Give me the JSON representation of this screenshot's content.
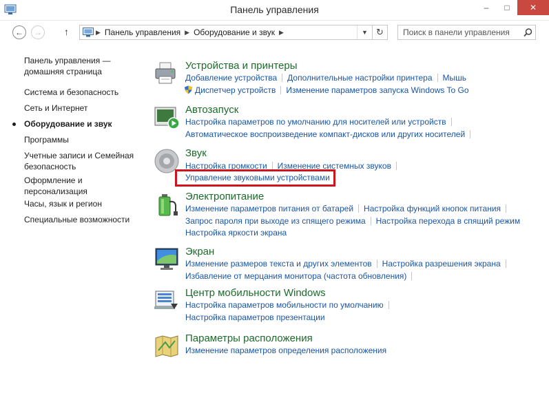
{
  "window": {
    "title": "Панель управления",
    "buttons": {
      "minimize": "–",
      "maximize": "□",
      "close": "✕"
    }
  },
  "address": {
    "crumbs": [
      "Панель управления",
      "Оборудование и звук"
    ],
    "search_placeholder": "Поиск в панели управления"
  },
  "sidebar": {
    "items": [
      "Панель управления — домашняя страница",
      "Система и безопасность",
      "Сеть и Интернет",
      "Оборудование и звук",
      "Программы",
      "Учетные записи и Семейная безопасность",
      "Оформление и персонализация",
      "Часы, язык и регион",
      "Специальные возможности"
    ],
    "current_index": 3
  },
  "categories": {
    "devices": {
      "title": "Устройства и принтеры",
      "links": [
        "Добавление устройства",
        "Дополнительные настройки принтера",
        "Мышь",
        "Диспетчер устройств",
        "Изменение параметров запуска Windows To Go"
      ]
    },
    "autoplay": {
      "title": "Автозапуск",
      "links": [
        "Настройка параметров по умолчанию для носителей или устройств",
        "Автоматическое воспроизведение компакт-дисков или других носителей"
      ]
    },
    "sound": {
      "title": "Звук",
      "links": [
        "Настройка громкости",
        "Изменение системных звуков",
        "Управление звуковыми устройствами"
      ]
    },
    "power": {
      "title": "Электропитание",
      "links": [
        "Изменение параметров питания от батарей",
        "Настройка функций кнопок питания",
        "Запрос пароля при выходе из спящего режима",
        "Настройка перехода в спящий режим",
        "Настройка яркости экрана"
      ]
    },
    "display": {
      "title": "Экран",
      "links": [
        "Изменение размеров текста и других элементов",
        "Настройка разрешения экрана",
        "Избавление от мерцания монитора (частота обновления)"
      ]
    },
    "mobility": {
      "title": "Центр мобильности Windows",
      "links": [
        "Настройка параметров мобильности по умолчанию",
        "Настройка параметров презентации"
      ]
    },
    "location": {
      "title": "Параметры расположения",
      "links": [
        "Изменение параметров определения расположения"
      ]
    }
  },
  "colors": {
    "link": "#1a55a5",
    "category_title": "#1c6b2b",
    "highlight": "#d0141d",
    "close_button": "#c9483f"
  }
}
